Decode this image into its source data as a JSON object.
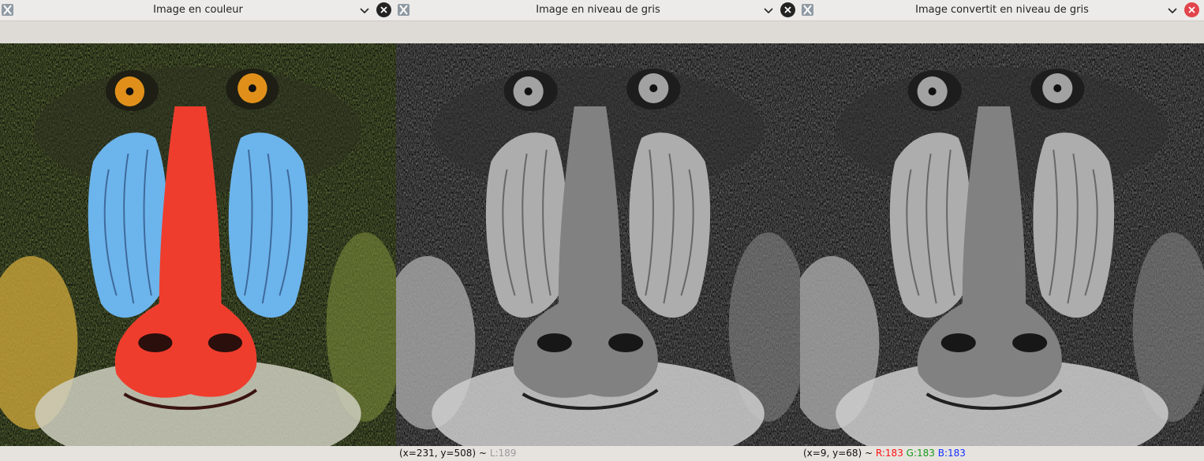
{
  "windows": [
    {
      "title": "Image en couleur",
      "close_state": "inactive",
      "image": {
        "content": "mandrill-face",
        "mode": "color"
      },
      "status": null
    },
    {
      "title": "Image en niveau de gris",
      "close_state": "inactive",
      "image": {
        "content": "mandrill-face",
        "mode": "grayscale"
      },
      "status": {
        "coords": "(x=231, y=508) ~",
        "luma_label": "L:189"
      }
    },
    {
      "title": "Image convertit en niveau de gris",
      "close_state": "hover-red",
      "image": {
        "content": "mandrill-face",
        "mode": "grayscale"
      },
      "status": {
        "coords": "(x=9, y=68) ~",
        "r_label": "R:183",
        "g_label": "G:183",
        "b_label": "B:183"
      }
    }
  ],
  "colors": {
    "status_r": "#ff1010",
    "status_g": "#1a9a1a",
    "status_b": "#1530ff",
    "status_l": "#9a9a9a",
    "close_active": "#e2444b"
  },
  "icons": {
    "app": "x-window-logo-icon",
    "menu": "chevron-down-icon",
    "close": "close-icon"
  }
}
